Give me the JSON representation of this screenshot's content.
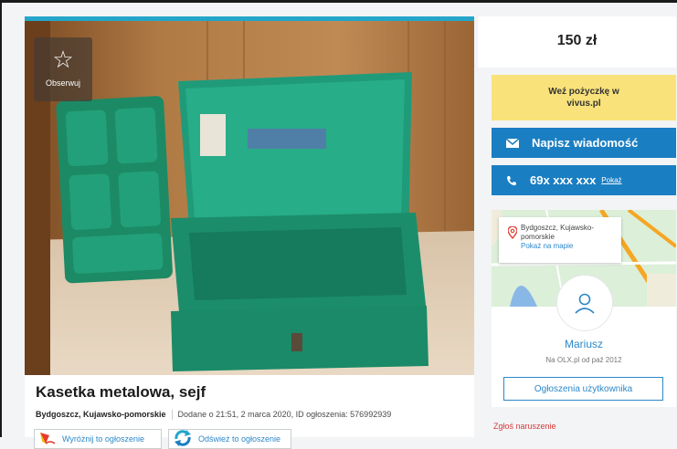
{
  "listing": {
    "title": "Kasetka metalowa, sejf",
    "location": "Bydgoszcz, Kujawsko-pomorskie",
    "added": "Dodane o 21:51, 2 marca 2020, ID ogłoszenia: 576992939",
    "follow_label": "Obserwuj",
    "photo_icon": "metal-box-photo"
  },
  "actions": {
    "highlight_label": "Wyróżnij to ogłoszenie",
    "refresh_label": "Odśwież to ogłoszenie"
  },
  "sidebar": {
    "price": "150 zł",
    "loan_text": "Weź pożyczkę w vivus.pl",
    "message_label": "Napisz wiadomość",
    "phone_number": "69x xxx xxx",
    "phone_show": "Pokaż",
    "map_location": "Bydgoszcz, Kujawsko-pomorskie",
    "map_link": "Pokaż na mapie",
    "user_name": "Mariusz",
    "user_since": "Na OLX.pl od paź 2012",
    "user_ads_label": "Ogłoszenia użytkownika",
    "report_label": "Zgłoś naruszenie"
  },
  "colors": {
    "accent_blue": "#1a7ec2",
    "loan_yellow": "#f9e27a",
    "top_bar": "#23a6c9",
    "report_red": "#d63c3c"
  }
}
